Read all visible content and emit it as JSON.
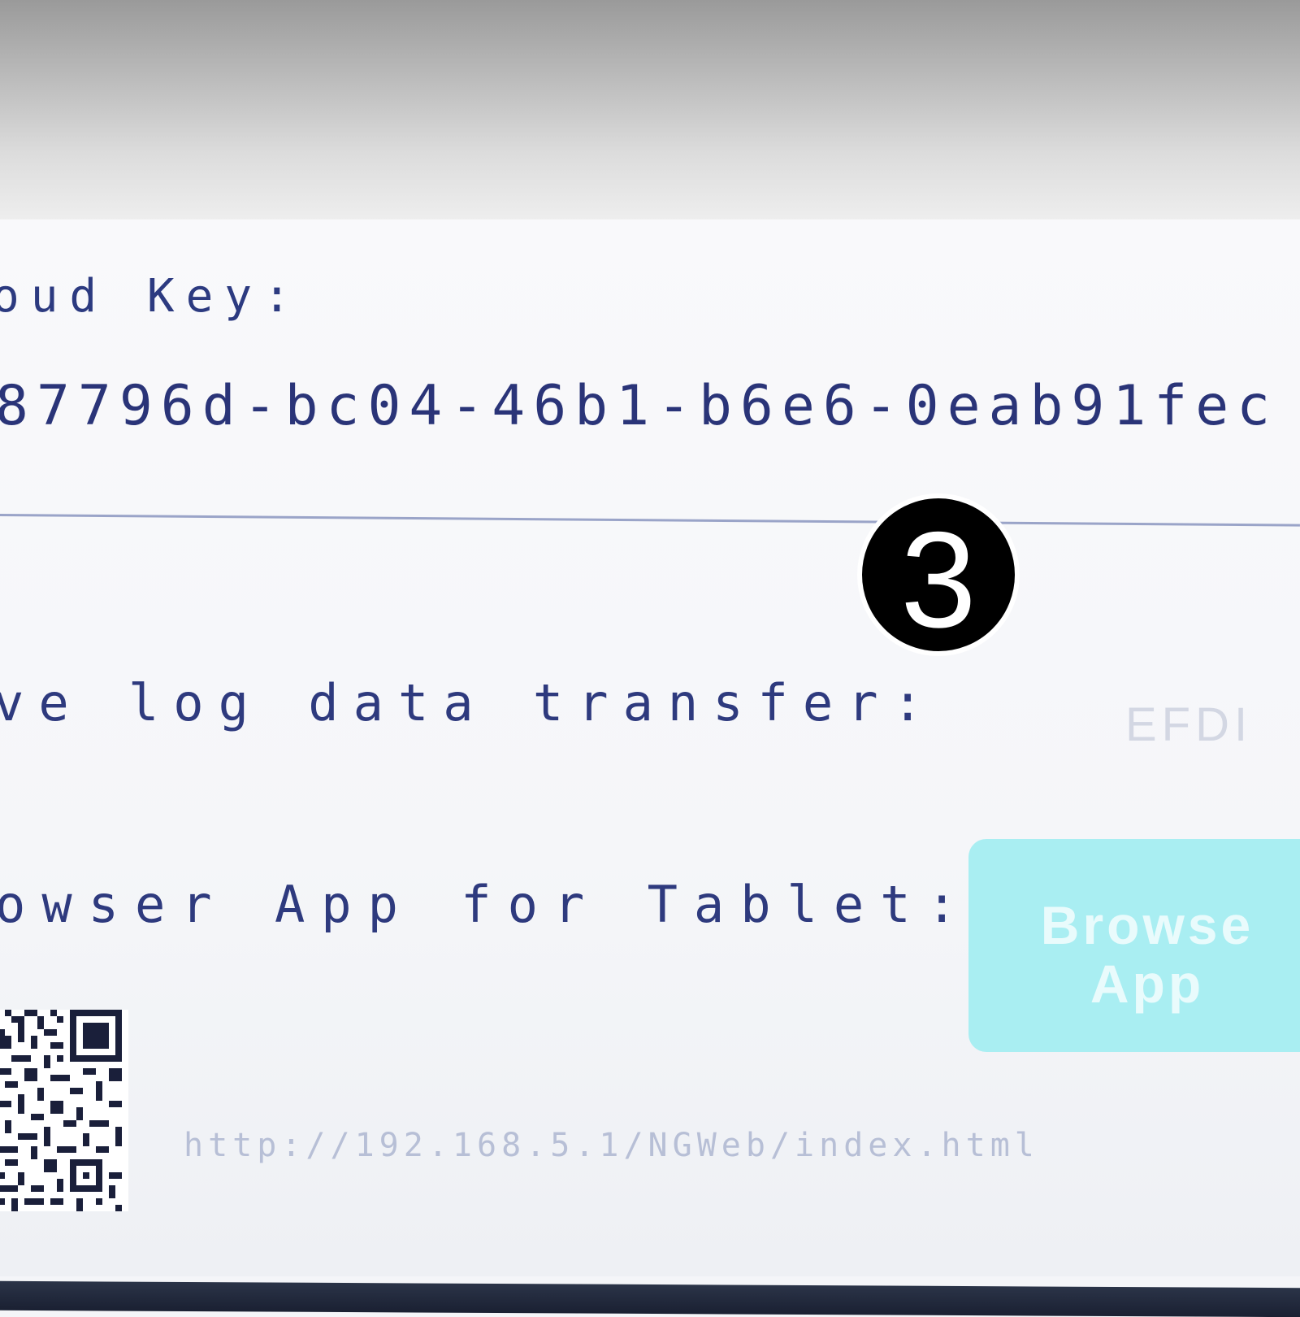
{
  "settings": {
    "cloud_key_label": "oud Key:",
    "cloud_key_value": "87796d-bc04-46b1-b6e6-0eab91fec",
    "log_transfer_label": "ve log data transfer:",
    "log_transfer_value": "EFDI",
    "browser_app_label": "owser App for Tablet:",
    "browser_button_line1": "Browse",
    "browser_button_line2": "App",
    "url": "http://192.168.5.1/NGWeb/index.html"
  },
  "annotation": {
    "step_number": "3"
  },
  "colors": {
    "text": "#2e3a7e",
    "button": "#a9eef2",
    "divider": "#9aa4c8"
  }
}
